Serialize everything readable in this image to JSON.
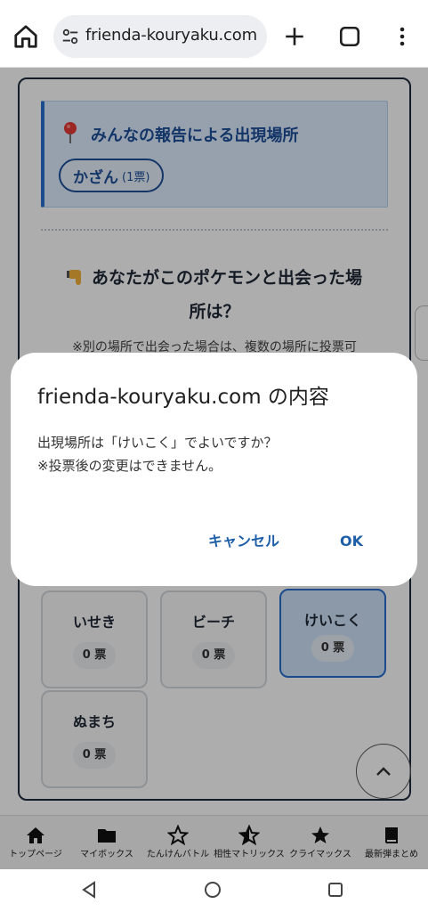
{
  "browser": {
    "url": "frienda-kouryaku.com",
    "icons": [
      "home-icon",
      "site-settings-icon",
      "new-tab-plus-icon",
      "tab-switcher-icon",
      "overflow-menu-icon"
    ]
  },
  "page": {
    "report_title": "みんなの報告による出現場所",
    "report_chip": {
      "name": "かざん",
      "votes": "(1票)"
    },
    "question_line1": "あなたがこのポケモンと出会った場",
    "question_line2": "所は？",
    "note": "※別の場所で出会った場合は、複数の場所に投票可",
    "tiles": [
      {
        "name": "いせき",
        "votes": "0 票"
      },
      {
        "name": "ビーチ",
        "votes": "0 票"
      },
      {
        "name": "けいこく",
        "votes": "0 票",
        "selected": true
      },
      {
        "name": "ぬまち",
        "votes": "0 票"
      }
    ]
  },
  "site_nav": [
    {
      "label": "トップページ",
      "icon": "home-icon"
    },
    {
      "label": "マイボックス",
      "icon": "folder-icon"
    },
    {
      "label": "たんけんバトル",
      "icon": "star-outline-icon"
    },
    {
      "label": "相性マトリックス",
      "icon": "star-half-icon"
    },
    {
      "label": "クライマックス",
      "icon": "star-filled-icon"
    },
    {
      "label": "最新弾まとめ",
      "icon": "book-icon"
    }
  ],
  "dialog": {
    "title": "frienda-kouryaku.com の内容",
    "message_line1": "出現場所は「けいこく」でよいですか？",
    "message_line2": "※投票後の変更はできません。",
    "cancel_label": "キャンセル",
    "ok_label": "OK"
  },
  "colors": {
    "accent": "#1e5fa8",
    "report_bg": "#dfeeff",
    "selected_tile_bg": "#cfe2f8",
    "scrim": "rgba(0,0,0,0.32)"
  }
}
